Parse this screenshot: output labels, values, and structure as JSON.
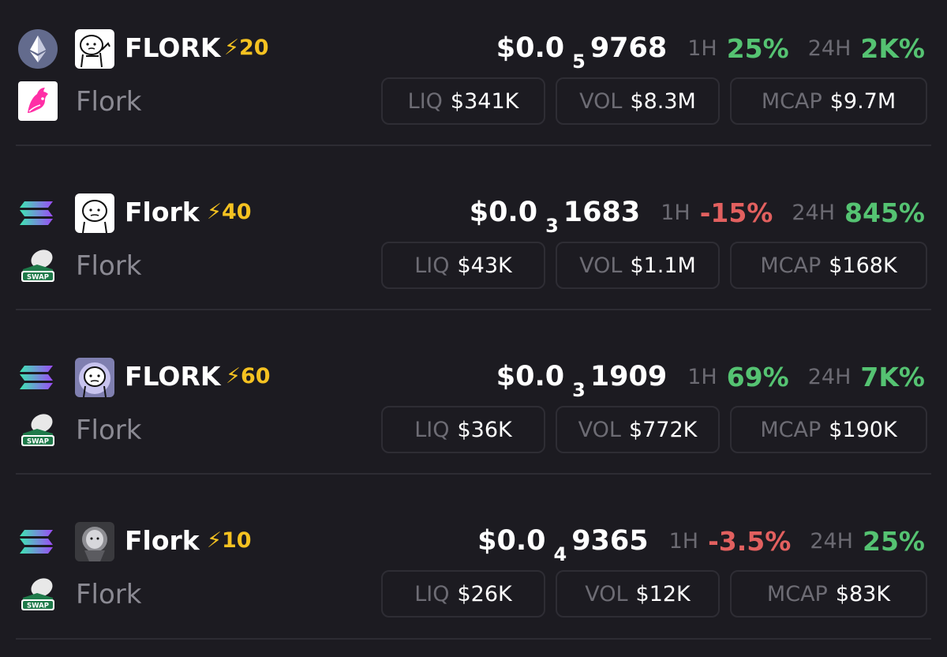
{
  "colors": {
    "background": "#1c1b21",
    "positive": "#55c372",
    "negative": "#e2605f",
    "boost": "#f5c221",
    "muted": "#6b6a72"
  },
  "rows": [
    {
      "chain_icon": "ethereum-icon",
      "dex_icon": "uniswap-icon",
      "symbol": "FLORK",
      "boost": "⚡20",
      "name": "Flork",
      "price_prefix": "$0.0",
      "price_zeros": "5",
      "price_digits": "9768",
      "h1_label": "1H",
      "h1_value": "25%",
      "h1_dir": "up",
      "h24_label": "24H",
      "h24_value": "2K%",
      "h24_dir": "up",
      "liq_label": "LIQ",
      "liq_value": "$341K",
      "vol_label": "VOL",
      "vol_value": "$8.3M",
      "mcap_label": "MCAP",
      "mcap_value": "$9.7M"
    },
    {
      "chain_icon": "solana-icon",
      "dex_icon": "swap-icon",
      "symbol": "Flork",
      "boost": "⚡40",
      "name": "Flork",
      "price_prefix": "$0.0",
      "price_zeros": "3",
      "price_digits": "1683",
      "h1_label": "1H",
      "h1_value": "-15%",
      "h1_dir": "down",
      "h24_label": "24H",
      "h24_value": "845%",
      "h24_dir": "up",
      "liq_label": "LIQ",
      "liq_value": "$43K",
      "vol_label": "VOL",
      "vol_value": "$1.1M",
      "mcap_label": "MCAP",
      "mcap_value": "$168K"
    },
    {
      "chain_icon": "solana-icon",
      "dex_icon": "swap-icon",
      "symbol": "FLORK",
      "boost": "⚡60",
      "name": "Flork",
      "price_prefix": "$0.0",
      "price_zeros": "3",
      "price_digits": "1909",
      "h1_label": "1H",
      "h1_value": "69%",
      "h1_dir": "up",
      "h24_label": "24H",
      "h24_value": "7K%",
      "h24_dir": "up",
      "liq_label": "LIQ",
      "liq_value": "$36K",
      "vol_label": "VOL",
      "vol_value": "$772K",
      "mcap_label": "MCAP",
      "mcap_value": "$190K"
    },
    {
      "chain_icon": "solana-icon",
      "dex_icon": "swap-icon",
      "symbol": "Flork",
      "boost": "⚡10",
      "name": "Flork",
      "price_prefix": "$0.0",
      "price_zeros": "4",
      "price_digits": "9365",
      "h1_label": "1H",
      "h1_value": "-3.5%",
      "h1_dir": "down",
      "h24_label": "24H",
      "h24_value": "25%",
      "h24_dir": "up",
      "liq_label": "LIQ",
      "liq_value": "$26K",
      "vol_label": "VOL",
      "vol_value": "$12K",
      "mcap_label": "MCAP",
      "mcap_value": "$83K"
    }
  ],
  "swap_icon_text": "SWAP"
}
